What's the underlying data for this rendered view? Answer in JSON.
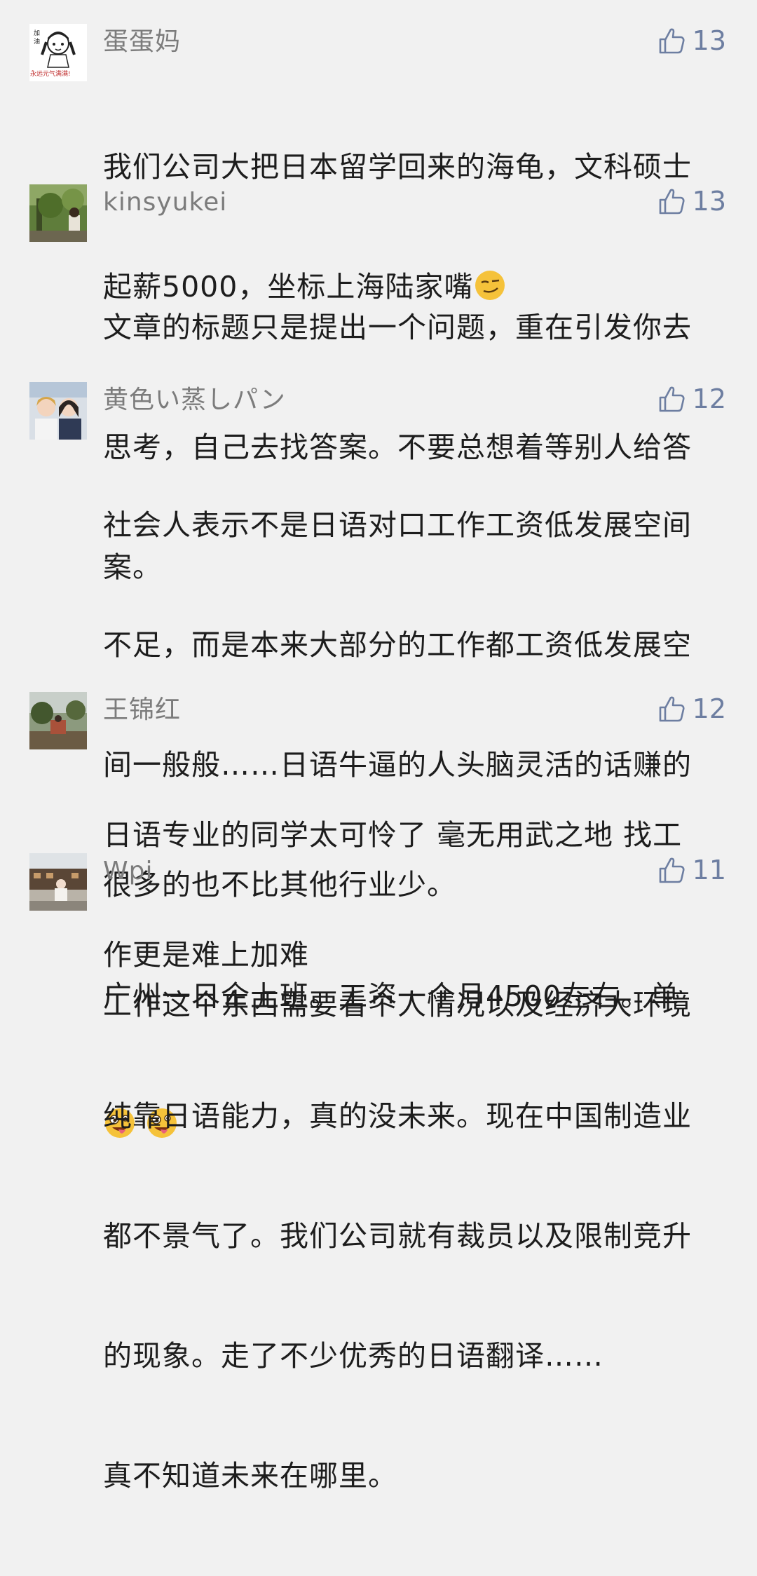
{
  "comments": [
    {
      "username": "蛋蛋妈",
      "likes": "13",
      "avatar_icon": "cartoon-girl-avatar",
      "avatar_text": "永远元气满满!",
      "lines": [
        "我们公司大把日本留学回来的海龟，文科硕士",
        "起薪5000，坐标上海陆家嘴"
      ],
      "emoji": "smirk-emoji"
    },
    {
      "username": "kinsyukei",
      "likes": "13",
      "avatar_icon": "garden-photo-avatar",
      "lines": [
        "文章的标题只是提出一个问题，重在引发你去",
        "思考，自己去找答案。不要总想着等别人给答",
        "案。"
      ]
    },
    {
      "username": "黄色い蒸しパン",
      "likes": "12",
      "avatar_icon": "two-girls-photo-avatar",
      "lines": [
        "社会人表示不是日语对口工作工资低发展空间",
        "不足，而是本来大部分的工作都工资低发展空",
        "间一般般……日语牛逼的人头脑灵活的话赚的",
        "很多的也不比其他行业少。",
        "工作这个东西需要看个人情况以及经济大环境"
      ],
      "emojis": [
        "crazy-face-emoji",
        "crazy-face-emoji"
      ]
    },
    {
      "username": "王锦红",
      "likes": "12",
      "avatar_icon": "outdoor-photo-avatar",
      "lines": [
        "日语专业的同学太可怜了 毫无用武之地 找工",
        "作更是难上加难"
      ]
    },
    {
      "username": "Wpi",
      "likes": "11",
      "avatar_icon": "street-photo-avatar",
      "lines": [
        "广州一日企上班。工资一个月4500左右。单",
        "纯靠日语能力，真的没未来。现在中国制造业",
        "都不景气了。我们公司就有裁员以及限制竞升",
        "的现象。走了不少优秀的日语翻译……",
        "真不知道未来在哪里。"
      ]
    }
  ],
  "colors": {
    "background": "#f1f1f1",
    "username": "#7c7c7c",
    "like": "#6d7ea1",
    "text": "#1d1d1d"
  }
}
